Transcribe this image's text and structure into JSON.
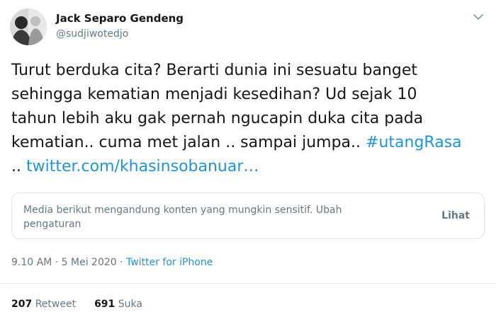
{
  "author": {
    "name": "Jack Separo Gendeng",
    "handle": "@sudjiwotedjo"
  },
  "tweet": {
    "lines": [
      "Turut berduka cita? Berarti dunia ini sesuatu banget",
      "sehingga kematian menjadi kesedihan? Ud sejak 10",
      "tahun lebih aku gak pernah ngucapin duka cita pada"
    ],
    "line4_text": "kematian.. cuma met jalan .. sampai jumpa.. ",
    "hashtag": "#utangRasa",
    "line5_prefix": ".. ",
    "url": "twitter.com/khasinsobanuar…"
  },
  "sensitive_notice": {
    "message": "Media berikut mengandung konten yang mungkin sensitif.",
    "settings_link": "Ubah pengaturan",
    "view_label": "Lihat"
  },
  "meta": {
    "time": "9.10 AM",
    "separator": " · ",
    "date": "5 Mei 2020",
    "source": "Twitter for iPhone"
  },
  "stats": {
    "retweet_count": "207",
    "retweet_label": "Retweet",
    "like_count": "691",
    "like_label": "Suka"
  },
  "colors": {
    "link": "#1b95e0",
    "secondary_text": "#657786",
    "primary_text": "#14171a",
    "border": "#dfe5ea"
  },
  "icons": {
    "caret": "chevron-down-icon",
    "avatar": "profile-photo"
  }
}
